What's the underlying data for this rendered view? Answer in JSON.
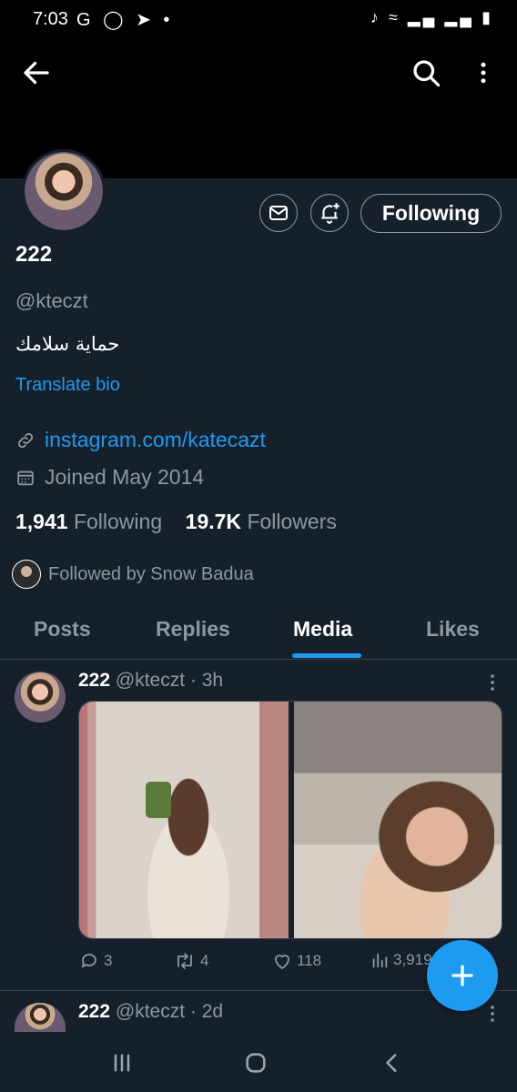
{
  "status_bar": {
    "time": "7:03",
    "left_icons": [
      "google-icon",
      "incognito-icon",
      "telegram-icon",
      "dot-icon"
    ],
    "right_icons": [
      "mute-icon",
      "wifi-icon",
      "signal-icon",
      "signal-icon",
      "battery-icon"
    ]
  },
  "profile": {
    "name": "222",
    "handle": "@kteczt",
    "bio": "حماية سلامك",
    "translate_label": "Translate bio",
    "link": "instagram.com/katecazt",
    "joined": "Joined May 2014",
    "following_count": "1,941",
    "following_label": "Following",
    "followers_count": "19.7K",
    "followers_label": "Followers",
    "followed_by": "Followed by Snow Badua",
    "follow_button_label": "Following"
  },
  "tabs": [
    {
      "label": "Posts"
    },
    {
      "label": "Replies"
    },
    {
      "label": "Media"
    },
    {
      "label": "Likes"
    }
  ],
  "posts": [
    {
      "name": "222",
      "handle_time": "@kteczt · 3h",
      "replies": "3",
      "reposts": "4",
      "likes": "118",
      "views": "3,919"
    },
    {
      "name": "222",
      "handle_time": "@kteczt · 2d"
    }
  ],
  "colors": {
    "background": "#15202b",
    "accent": "#1d9bf0",
    "muted": "#8b98a5"
  }
}
